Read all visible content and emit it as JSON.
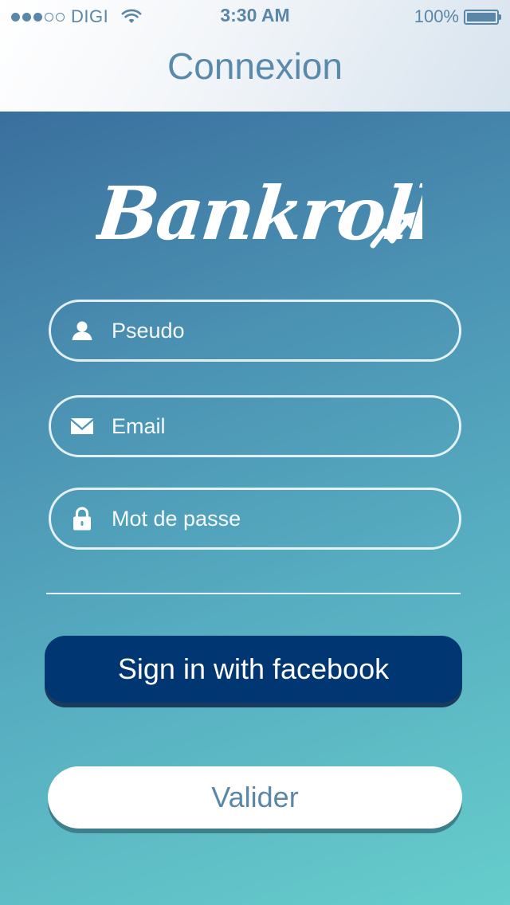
{
  "status_bar": {
    "carrier": "DIGI",
    "time": "3:30 AM",
    "battery": "100%",
    "signal_bars_filled": 3,
    "signal_bars_total": 5,
    "icons": [
      "wifi-icon",
      "battery-icon"
    ]
  },
  "header": {
    "title": "Connexion"
  },
  "logo": {
    "text": "Bankroll"
  },
  "form": {
    "pseudo": {
      "placeholder": "Pseudo",
      "value": "",
      "icon": "user-icon"
    },
    "email": {
      "placeholder": "Email",
      "value": "",
      "icon": "envelope-icon"
    },
    "password": {
      "placeholder": "Mot de passe",
      "value": "",
      "icon": "lock-icon"
    }
  },
  "buttons": {
    "facebook": "Sign in with facebook",
    "submit": "Valider"
  },
  "colors": {
    "header_text": "#5a8aab",
    "facebook_button": "#003672",
    "gradient_top": "#3a6f9d",
    "gradient_bottom": "#66cdcb"
  }
}
